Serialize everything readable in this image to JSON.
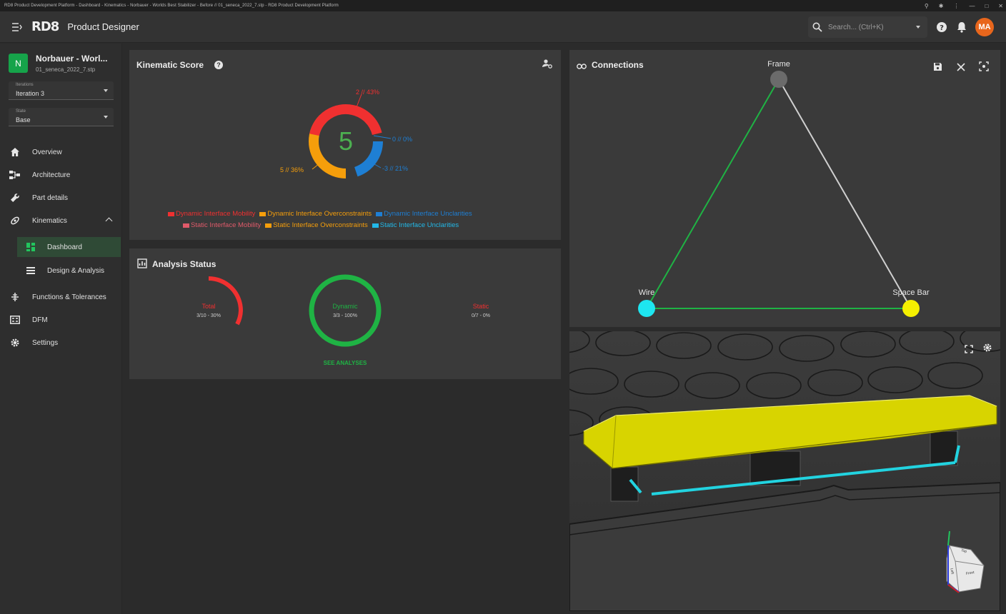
{
  "titlebar": {
    "text": "RD8 Product Development Platform - Dashboard - Kinematics - Norbauer - Worlds Best Stabilizer - Before // 01_seneca_2022_7.stp - RD8 Product Development Platform"
  },
  "header": {
    "logo": "RD8",
    "title": "Product Designer",
    "search_placeholder": "Search... (Ctrl+K)",
    "avatar": "MA"
  },
  "sidebar": {
    "project_badge": "N",
    "project_name": "Norbauer - Worl...",
    "project_file": "01_seneca_2022_7.stp",
    "iterations_label": "Iterations",
    "iterations_value": "Iteration 3",
    "state_label": "State",
    "state_value": "Base",
    "items": [
      {
        "label": "Overview",
        "icon": "home-icon"
      },
      {
        "label": "Architecture",
        "icon": "architecture-icon"
      },
      {
        "label": "Part details",
        "icon": "wrench-icon"
      },
      {
        "label": "Kinematics",
        "icon": "kinematics-icon"
      },
      {
        "label": "Dashboard",
        "icon": "dashboard-icon"
      },
      {
        "label": "Design & Analysis",
        "icon": "list-icon"
      },
      {
        "label": "Functions & Tolerances",
        "icon": "tolerance-icon"
      },
      {
        "label": "DFM",
        "icon": "dfm-icon"
      },
      {
        "label": "Settings",
        "icon": "gear-icon"
      }
    ]
  },
  "kinematic_score": {
    "title": "Kinematic Score",
    "score": "5",
    "labels": {
      "red": "2 // 43%",
      "blue_top": "0 // 0%",
      "orange": "5 // 36%",
      "blue_bottom": "-3 // 21%"
    },
    "legend_row1": [
      "Dynamic Interface Mobility",
      "Dynamic Interface Overconstraints",
      "Dynamic Interface Unclarities"
    ],
    "legend_row2": [
      "Static Interface Mobility",
      "Static Interface Overconstraints",
      "Static Interface Unclarities"
    ],
    "colors": {
      "mobility": "#f03030",
      "overconstraints": "#f59e0b",
      "unclarities": "#1e7fd4",
      "static_mobility": "#e05a6a",
      "static_unclarities": "#22b8e8"
    },
    "segments": [
      {
        "name": "Dynamic Interface Mobility",
        "value": 43
      },
      {
        "name": "Dynamic Interface Unclarities",
        "value": 21
      },
      {
        "name": "Dynamic Interface Overconstraints",
        "value": 36
      }
    ]
  },
  "analysis_status": {
    "title": "Analysis Status",
    "total_label": "Total",
    "total_value": "3/10 - 30%",
    "total_fraction": 0.3,
    "dynamic_label": "Dynamic",
    "dynamic_value": "3/3 - 100%",
    "dynamic_fraction": 1.0,
    "static_label": "Static",
    "static_value": "0/7 - 0%",
    "static_fraction": 0.0,
    "see_analyses": "SEE ANALYSES"
  },
  "connections": {
    "title": "Connections",
    "nodes": {
      "frame": "Frame",
      "wire": "Wire",
      "space_bar": "Space Bar"
    }
  },
  "viewcube": {
    "top": "Top",
    "front": "Front",
    "left": "Left"
  }
}
